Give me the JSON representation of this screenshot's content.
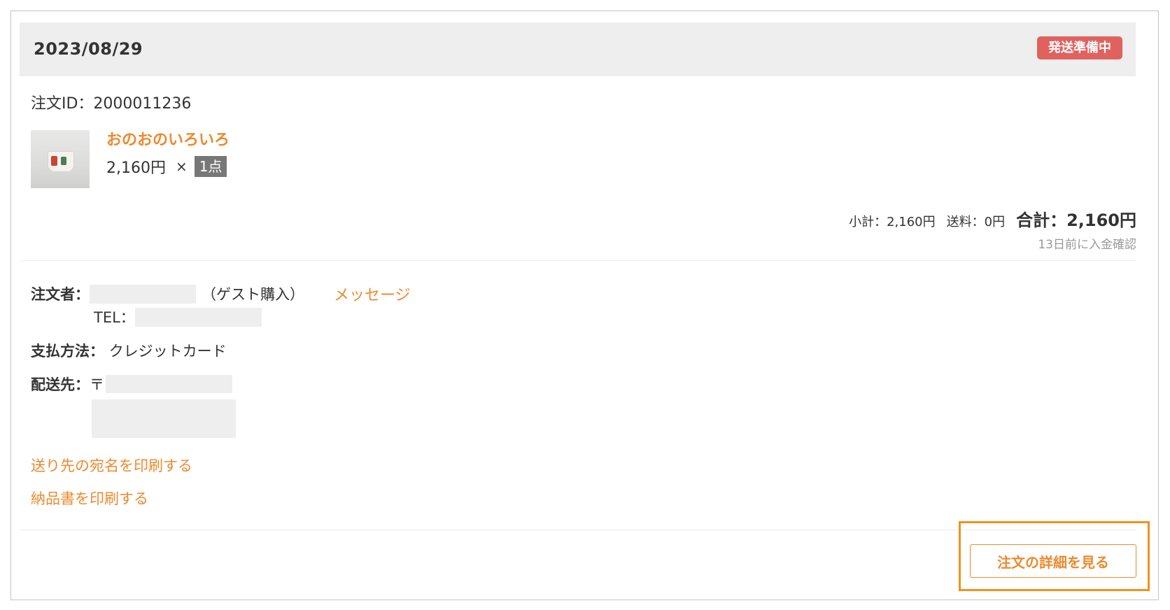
{
  "order": {
    "date": "2023/08/29",
    "status": "発送準備中",
    "order_id_label": "注文ID：2000011236"
  },
  "item": {
    "name": "おのおのいろいろ",
    "price": "2,160円",
    "times": "×",
    "quantity": "1点"
  },
  "totals": {
    "subtotal": "小計：2,160円",
    "shipping": "送料：0円",
    "grand_total": "合計：2,160円",
    "payment_note": "13日前に入金確認"
  },
  "buyer": {
    "label": "注文者：",
    "guest_note": "（ゲスト購入）",
    "message_link": "メッセージ",
    "tel_label": "TEL："
  },
  "payment": {
    "label": "支払方法：",
    "method": "クレジットカード"
  },
  "shipping_address": {
    "label": "配送先：",
    "postal_mark": "〒"
  },
  "links": {
    "print_address": "送り先の宛名を印刷する",
    "print_invoice": "納品書を印刷する"
  },
  "actions": {
    "view_details": "注文の詳細を見る"
  },
  "colors": {
    "accent": "#ec8a2e",
    "status_badge": "#e0625e",
    "header_bg": "#eeeeee",
    "highlight_border": "#f0921e"
  }
}
